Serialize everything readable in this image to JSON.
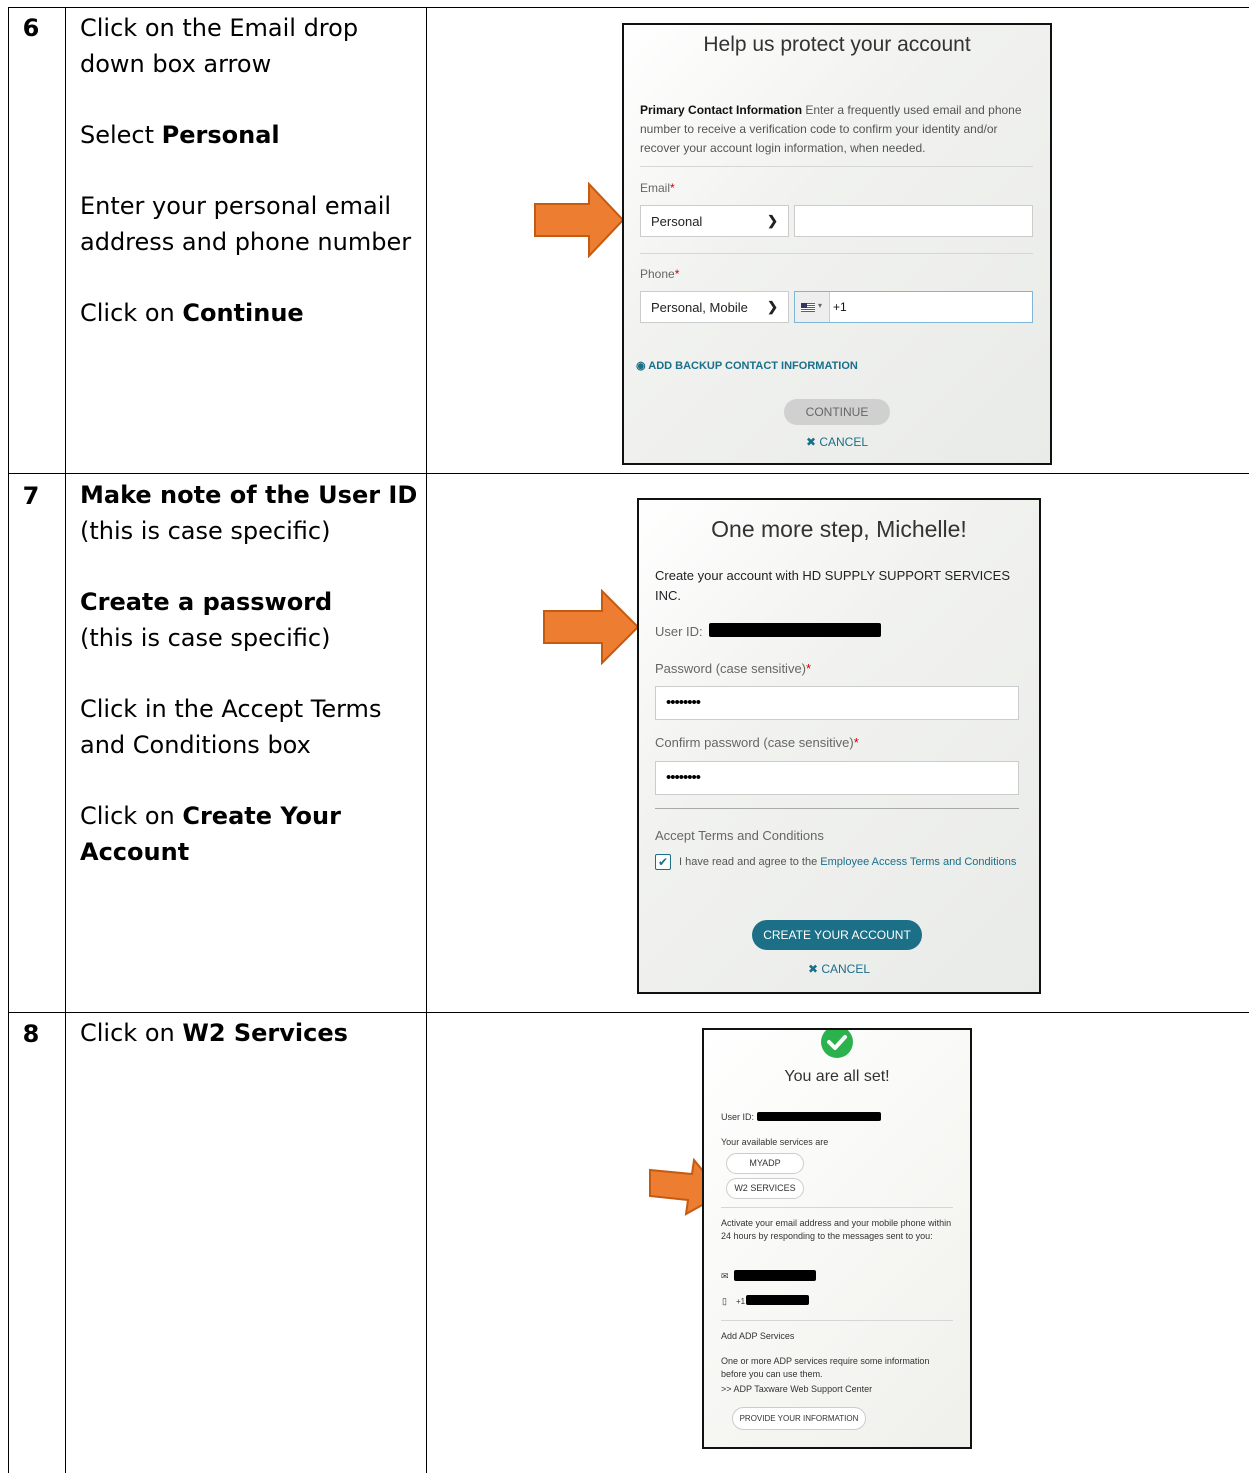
{
  "rows": [
    {
      "step": "6",
      "instructions": [
        {
          "pre": "Click on the Email drop down box arrow",
          "bold": "",
          "post": ""
        },
        {
          "pre": "Select ",
          "bold": "Personal",
          "post": ""
        },
        {
          "pre": "Enter your personal email address and phone number",
          "bold": "",
          "post": ""
        },
        {
          "pre": "Click on ",
          "bold": "Continue",
          "post": ""
        }
      ]
    },
    {
      "step": "7",
      "instructions": [
        {
          "pre": "",
          "bold": "Make note of the User ID",
          "post": "(this is case specific)"
        },
        {
          "pre": "",
          "bold": "Create a password",
          "post": "(this is case specific)"
        },
        {
          "pre": "Click in the Accept Terms and Conditions box",
          "bold": "",
          "post": ""
        },
        {
          "pre": "Click on ",
          "bold": "Create Your Account",
          "post": ""
        }
      ]
    },
    {
      "step": "8",
      "instructions": [
        {
          "pre": "Click on ",
          "bold": "W2 Services",
          "post": ""
        }
      ]
    }
  ],
  "shot1": {
    "title": "Help us protect your account",
    "intro_bold": "Primary Contact Information",
    "intro_text": " Enter a frequently used email and phone number to receive a verification code to confirm your identity and/or recover your account login information, when needed.",
    "email_label": "Email",
    "email_type": "Personal",
    "phone_label": "Phone",
    "phone_type": "Personal, Mobile",
    "phone_prefix": "+1",
    "backup_link": "ADD BACKUP CONTACT INFORMATION",
    "continue": "CONTINUE",
    "cancel": "CANCEL",
    "required_mark": "*"
  },
  "shot2": {
    "title": "One more step, Michelle!",
    "create_text": "Create your account with HD SUPPLY SUPPORT SERVICES INC.",
    "userid_label": "User ID:",
    "password_label": "Password (case sensitive)",
    "password_value": "••••••••",
    "confirm_label": "Confirm password (case sensitive)",
    "confirm_value": "••••••••",
    "terms_heading": "Accept Terms and Conditions",
    "terms_text": "I have read and agree to the ",
    "terms_link": "Employee Access Terms and Conditions",
    "create_button": "CREATE YOUR ACCOUNT",
    "cancel": "CANCEL",
    "required_mark": "*"
  },
  "shot3": {
    "title": "You are all set!",
    "userid_label": "User ID:",
    "services_label": "Your available services are",
    "service1": "MYADP",
    "service2": "W2 SERVICES",
    "activate_text": "Activate your email address and your mobile phone within 24 hours by responding to the messages sent to you:",
    "phone_prefix": "+1",
    "add_services": "Add ADP Services",
    "info_text": "One or more ADP services require some information before you can use them.",
    "taxware": ">>  ADP Taxware Web Support Center",
    "provide_button": "PROVIDE YOUR INFORMATION"
  },
  "colors": {
    "arrow_fill": "#ed7d31",
    "arrow_stroke": "#c55a11",
    "teal_button": "#1b6f87",
    "link": "#1a6f8a",
    "success_green": "#2bb24c"
  }
}
